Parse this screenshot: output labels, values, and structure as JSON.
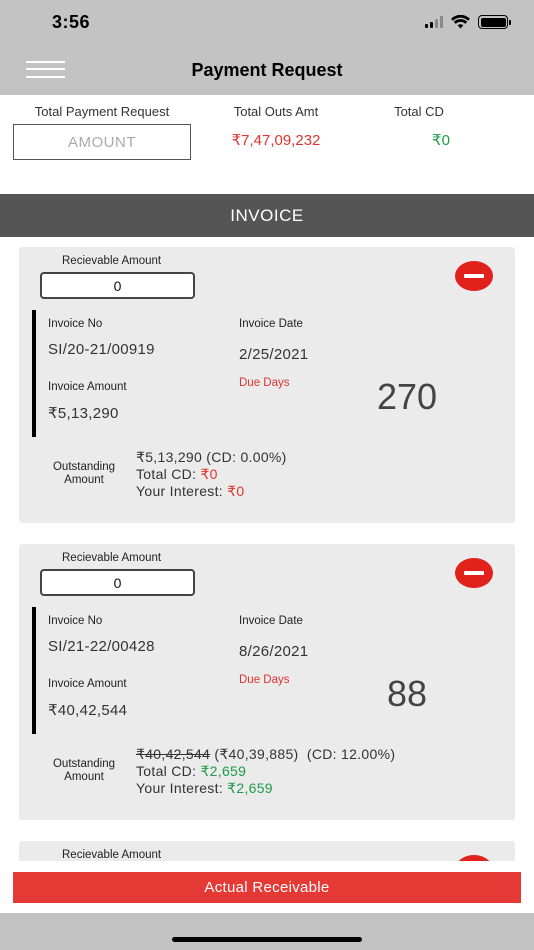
{
  "status_bar": {
    "time": "3:56"
  },
  "header": {
    "title": "Payment Request"
  },
  "summary": {
    "total_payment_label": "Total Payment Request",
    "amount_placeholder": "AMOUNT",
    "total_outs_label": "Total Outs Amt",
    "total_outs_value": "₹7,47,09,232",
    "total_cd_label": "Total CD",
    "total_cd_value": "₹0"
  },
  "section": {
    "title": "INVOICE"
  },
  "invoices": [
    {
      "receivable_label": "Recievable Amount",
      "receivable_value": "0",
      "invoice_no_label": "Invoice No",
      "invoice_no": "SI/20-21/00919",
      "invoice_date_label": "Invoice Date",
      "invoice_date": "2/25/2021",
      "invoice_amount_label": "Invoice Amount",
      "invoice_amount": "₹5,13,290",
      "due_days_label": "Due Days",
      "due_days": "270",
      "outstanding_label": "Outstanding Amount",
      "outstanding_line": "₹5,13,290 (CD: 0.00%)",
      "total_cd_label": "Total CD: ",
      "total_cd": "₹0",
      "your_interest_label": "Your Interest: ",
      "your_interest": "₹0"
    },
    {
      "receivable_label": "Recievable Amount",
      "receivable_value": "0",
      "invoice_no_label": "Invoice No",
      "invoice_no": "SI/21-22/00428",
      "invoice_date_label": "Invoice Date",
      "invoice_date": "8/26/2021",
      "invoice_amount_label": "Invoice Amount",
      "invoice_amount": "₹40,42,544",
      "due_days_label": "Due Days",
      "due_days": "88",
      "outstanding_label": "Outstanding Amount",
      "outstanding_original": "₹40,42,544",
      "outstanding_discounted": " (₹40,39,885)",
      "outstanding_cd": "  (CD: 12.00%)",
      "total_cd_label": "Total CD: ",
      "total_cd": "₹2,659",
      "your_interest_label": "Your Interest: ",
      "your_interest": "₹2,659"
    },
    {
      "receivable_label": "Recievable Amount"
    }
  ],
  "footer": {
    "action_label": "Actual Receivable"
  },
  "colors": {
    "accent_red": "#e53935",
    "positive_green": "#1d9c4a",
    "header_gray": "#c3c3c3",
    "section_gray": "#555555"
  }
}
